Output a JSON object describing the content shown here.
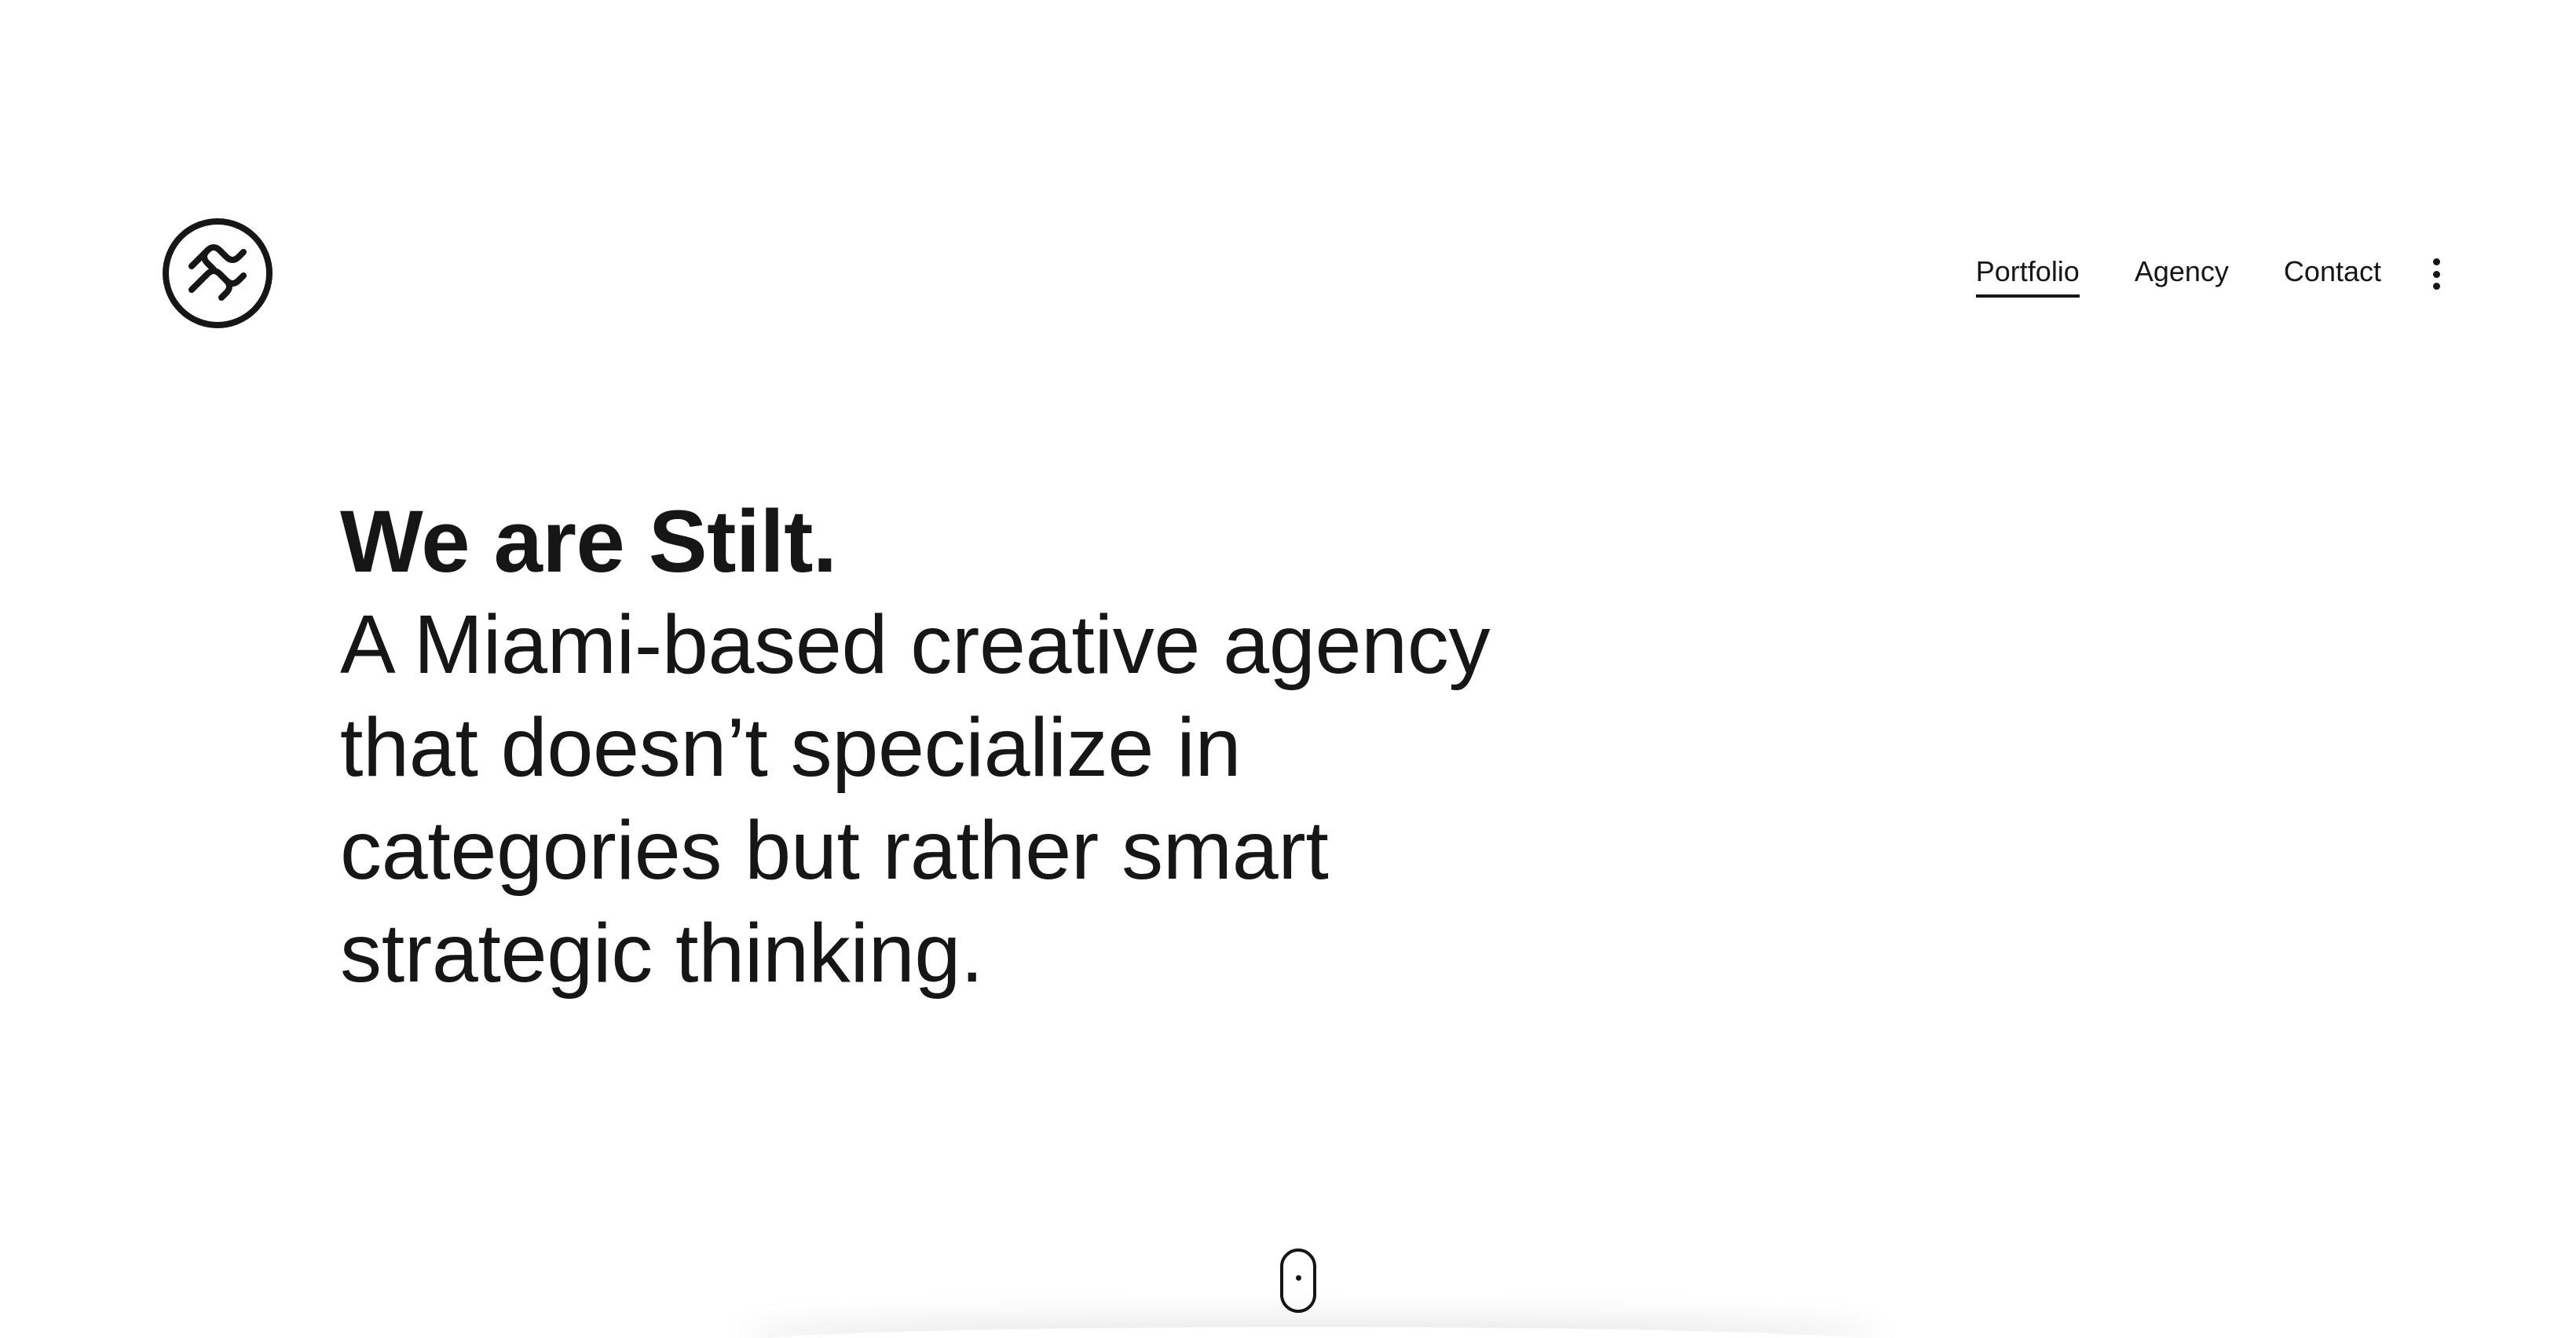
{
  "brand": {
    "logo_icon": "stilt-logo-icon"
  },
  "nav": {
    "items": [
      {
        "label": "Portfolio",
        "active": true
      },
      {
        "label": "Agency",
        "active": false
      },
      {
        "label": "Contact",
        "active": false
      }
    ],
    "more_icon": "vertical-ellipsis-icon"
  },
  "hero": {
    "title": "We are Stilt.",
    "text": "A Miami-based creative agency that doesn’t specialize in categories but rather smart strategic thinking."
  },
  "scroll": {
    "icon": "mouse-scroll-icon"
  },
  "colors": {
    "background": "#ffffff",
    "text": "#161616"
  }
}
